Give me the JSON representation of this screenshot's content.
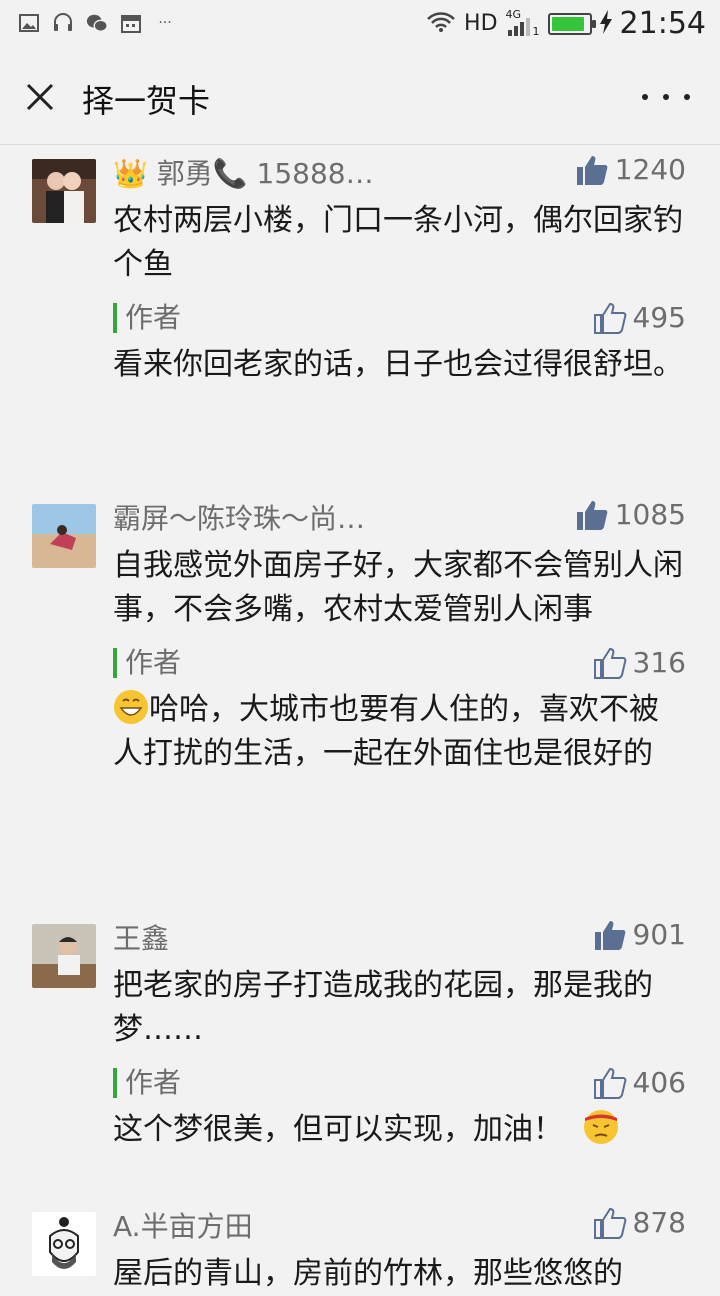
{
  "status_bar": {
    "network": "HD",
    "network_gen": "4G",
    "sim": "1",
    "time": "21:54",
    "battery_level": 1.0,
    "battery_color": "#35c43a"
  },
  "header": {
    "title": "择一贺卡",
    "close_icon": "close-icon",
    "more_icon": "more-icon"
  },
  "comments": [
    {
      "name": "👑 郭勇📞 15888…",
      "likes": "1240",
      "liked": true,
      "text": "农村两层小楼，门口一条小河，偶尔回家钓个鱼",
      "reply": {
        "author_label": "作者",
        "likes": "495",
        "text": "看来你回老家的话，日子也会过得很舒坦。"
      }
    },
    {
      "name": "霸屏～陈玲珠～尚…",
      "likes": "1085",
      "liked": true,
      "text": "自我感觉外面房子好，大家都不会管别人闲事，不会多嘴，农村太爱管别人闲事",
      "reply": {
        "author_label": "作者",
        "likes": "316",
        "text": "哈哈，大城市也要有人住的，喜欢不被人打扰的生活，一起在外面住也是很好的"
      }
    },
    {
      "name": "王鑫",
      "likes": "901",
      "liked": true,
      "text": "把老家的房子打造成我的花园，那是我的梦……",
      "reply": {
        "author_label": "作者",
        "likes": "406",
        "text": "这个梦很美，但可以实现，加油！"
      }
    },
    {
      "name": "A.半亩方田",
      "likes": "878",
      "liked": false,
      "text": "屋后的青山，房前的竹林，那些悠悠的"
    }
  ]
}
